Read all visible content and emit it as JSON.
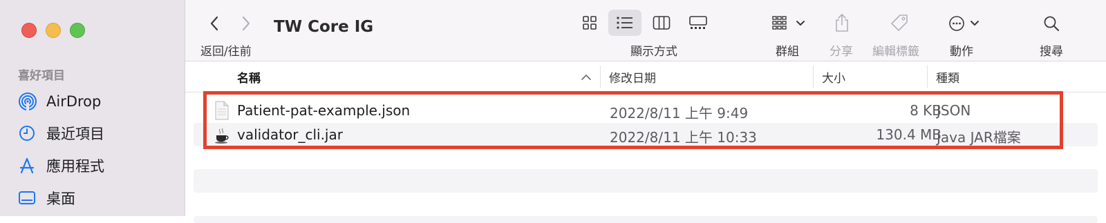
{
  "sidebar": {
    "section_title": "喜好項目",
    "items": [
      {
        "label": "AirDrop",
        "icon": "airdrop-icon"
      },
      {
        "label": "最近項目",
        "icon": "clock-icon"
      },
      {
        "label": "應用程式",
        "icon": "applications-icon"
      },
      {
        "label": "桌面",
        "icon": "desktop-icon"
      }
    ]
  },
  "toolbar": {
    "nav_label": "返回/往前",
    "title": "TW Core IG",
    "view_label": "顯示方式",
    "group_label": "群組",
    "share_label": "分享",
    "tags_label": "編輯標籤",
    "action_label": "動作",
    "search_label": "搜尋"
  },
  "columns": {
    "name": "名稱",
    "date": "修改日期",
    "size": "大小",
    "kind": "種類"
  },
  "files": [
    {
      "name": "Patient-pat-example.json",
      "date": "2022/8/11 上午 9:49",
      "size": "8 KB",
      "kind": "JSON",
      "icon": "json-file-icon"
    },
    {
      "name": "validator_cli.jar",
      "date": "2022/8/11 上午 10:33",
      "size": "130.4 MB",
      "kind": "Java JAR檔案",
      "icon": "java-jar-icon"
    }
  ],
  "colors": {
    "highlight": "#e2412f",
    "accent": "#1b78f2"
  }
}
